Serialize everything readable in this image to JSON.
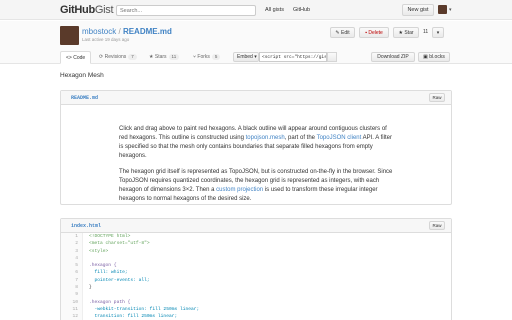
{
  "header": {
    "logo_main": "GitHub",
    "logo_sub": "Gist",
    "search_placeholder": "Search...",
    "nav": [
      "All gists",
      "GitHub"
    ],
    "new_gist": "New gist"
  },
  "gist": {
    "owner": "mbostock",
    "separator": "/",
    "file": "README.md",
    "meta": "Last active 19 days ago",
    "actions": {
      "edit": "Edit",
      "delete": "Delete",
      "star": "Star",
      "star_count": "11"
    }
  },
  "tabs": [
    {
      "label": "Code",
      "count": ""
    },
    {
      "label": "Revisions",
      "count": "7"
    },
    {
      "label": "Stars",
      "count": "11"
    },
    {
      "label": "Forks",
      "count": "5"
    }
  ],
  "embed": {
    "label": "Embed",
    "value": "<script src=\"https://gis",
    "download": "Download ZIP",
    "blocks": "bl.ocks"
  },
  "description": "Hexagon Mesh",
  "readme": {
    "filename": "README.md",
    "raw": "Raw",
    "p1_a": "Click and drag above to paint red hexagons. A black outline will appear around contiguous clusters of red hexagons. This outline is constructed using ",
    "p1_link1": "topojson.mesh",
    "p1_b": ", part of the ",
    "p1_link2": "TopoJSON client",
    "p1_c": " API. A filter is specified so that the mesh only contains boundaries that separate filled hexagons from empty hexagons.",
    "p2_a": "The hexagon grid itself is represented as TopoJSON, but is constructed on-the-fly in the browser. Since TopoJSON requires quantized coordinates, the hexagon grid is represented as integers, with each hexagon of dimensions 3×2. Then a ",
    "p2_link": "custom projection",
    "p2_b": " is used to transform these irregular integer hexagons to normal hexagons of the desired size."
  },
  "index": {
    "filename": "index.html",
    "raw": "Raw",
    "lines": [
      {
        "n": "1",
        "t": "<!DOCTYPE html>"
      },
      {
        "n": "2",
        "t": "<meta charset=\"utf-8\">"
      },
      {
        "n": "3",
        "t": "<style>"
      },
      {
        "n": "4",
        "t": ""
      },
      {
        "n": "5",
        "t": ".hexagon {"
      },
      {
        "n": "6",
        "t": "  fill: white;"
      },
      {
        "n": "7",
        "t": "  pointer-events: all;"
      },
      {
        "n": "8",
        "t": "}"
      },
      {
        "n": "9",
        "t": ""
      },
      {
        "n": "10",
        "t": ".hexagon path {"
      },
      {
        "n": "11",
        "t": "  -webkit-transition: fill 250ms linear;"
      },
      {
        "n": "12",
        "t": "  transition: fill 250ms linear;"
      }
    ]
  },
  "colors": {
    "link": "#4183c4",
    "delete": "#bb0000",
    "header_bg": "#f5f5f5"
  }
}
